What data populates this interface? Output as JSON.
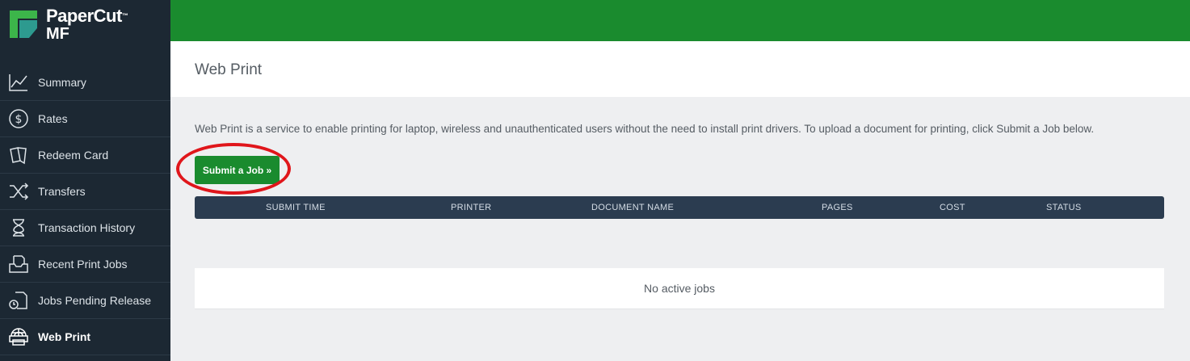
{
  "brand": {
    "name": "PaperCut",
    "trademark": "™",
    "sub": "MF"
  },
  "colors": {
    "accent_green": "#1a8b2e",
    "sidebar_bg": "#1c2833",
    "table_header_bg": "#2b3c50",
    "highlight_red": "#e0161b"
  },
  "sidebar": {
    "items": [
      {
        "label": "Summary",
        "icon": "chart-line-icon"
      },
      {
        "label": "Rates",
        "icon": "dollar-circle-icon"
      },
      {
        "label": "Redeem Card",
        "icon": "cards-icon"
      },
      {
        "label": "Transfers",
        "icon": "shuffle-icon"
      },
      {
        "label": "Transaction History",
        "icon": "hourglass-icon"
      },
      {
        "label": "Recent Print Jobs",
        "icon": "inbox-tray-icon"
      },
      {
        "label": "Jobs Pending Release",
        "icon": "document-clock-icon"
      },
      {
        "label": "Web Print",
        "icon": "globe-printer-icon",
        "active": true
      }
    ]
  },
  "page": {
    "title": "Web Print"
  },
  "main": {
    "intro": "Web Print is a service to enable printing for laptop, wireless and unauthenticated users without the need to install print drivers. To upload a document for printing, click Submit a Job below.",
    "submit_label": "Submit a Job »",
    "table": {
      "columns": [
        "SUBMIT TIME",
        "PRINTER",
        "DOCUMENT NAME",
        "PAGES",
        "COST",
        "STATUS"
      ],
      "empty_message": "No active jobs"
    }
  }
}
